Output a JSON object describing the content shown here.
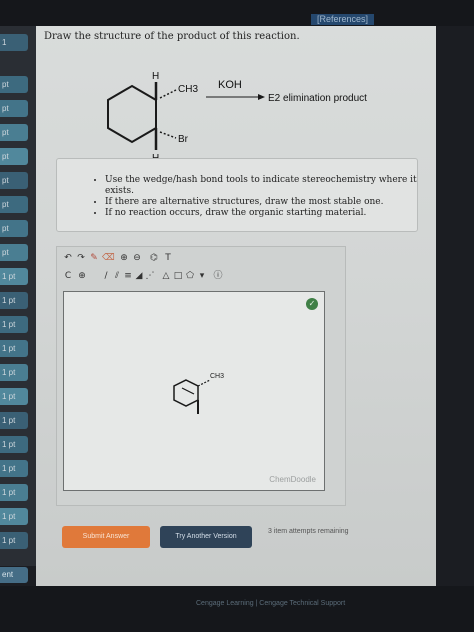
{
  "header": {
    "references_label": "[References]"
  },
  "sidebar": {
    "items": [
      "1",
      "pt",
      "pt",
      "pt",
      "pt",
      "pt",
      "pt",
      "pt",
      "pt",
      "1 pt",
      "1 pt",
      "1 pt",
      "1 pt",
      "1 pt",
      "1 pt",
      "1 pt",
      "1 pt",
      "1 pt",
      "1 pt",
      "1 pt",
      "1 pt"
    ],
    "bottom_label": "ent"
  },
  "question": {
    "prompt": "Draw the structure of the product of this reaction.",
    "reaction": {
      "reagent": "KOH",
      "product_label": "E2 elimination product",
      "h_top": "H",
      "h_bottom": "H",
      "ch3_label": "CH3",
      "br_label": "Br"
    },
    "instructions": [
      "Use the wedge/hash bond tools to indicate stereochemistry where it exists.",
      "If there are alternative structures, draw the most stable one.",
      "If no reaction occurs, draw the organic starting material."
    ]
  },
  "editor": {
    "toolbar_row1": [
      "undo",
      "redo",
      "pencil",
      "eraser",
      "zoom-in",
      "zoom-out",
      "template",
      "text"
    ],
    "toolbar_row2": [
      "c-atom",
      "charge",
      "bond-single",
      "bond-double",
      "bond-triple",
      "bond-wedge",
      "bond-hash",
      "ring-cyclopropane",
      "ring-cyclobutane",
      "ring-cyclopentane",
      "ring-menu",
      "info"
    ],
    "drawn_label": "CH3",
    "watermark": "ChemDoodle",
    "status_icon": "check-icon"
  },
  "actions": {
    "submit_label": "Submit Answer",
    "try_another_label": "Try Another Version",
    "attempts_text": "3 item attempts remaining"
  },
  "footer": {
    "text": "Cengage Learning  |  Cengage Technical Support"
  }
}
